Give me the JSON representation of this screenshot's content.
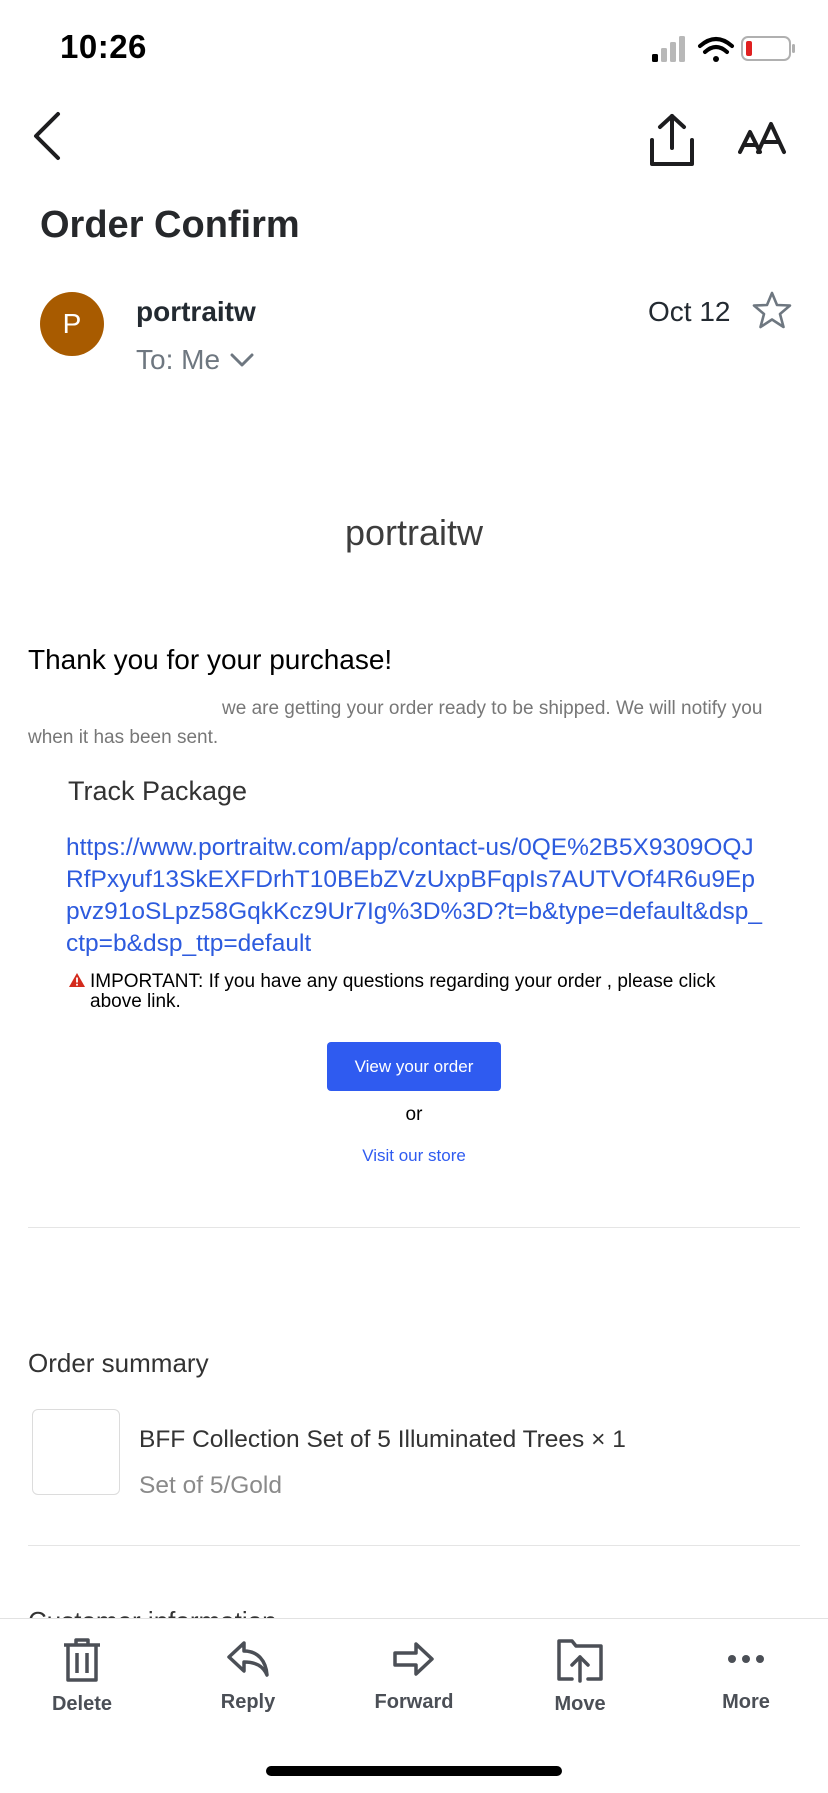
{
  "status_bar": {
    "time": "10:26"
  },
  "email": {
    "subject": "Order Confirm",
    "sender": {
      "initial": "P",
      "name": "portraitw"
    },
    "recipient": "To: Me",
    "date": "Oct 12"
  },
  "body": {
    "brand": "portraitw",
    "thanks": "Thank you for your purchase!",
    "message": "we are getting your order ready to be shipped. We will notify you when it has been sent.",
    "track_title": "Track Package",
    "track_link": "https://www.portraitw.com/app/contact-us/0QE%2B5X9309OQJRfPxyuf13SkEXFDrhT10BEbZVzUxpBFqpIs7AUTVOf4R6u9Eppvz91oSLpz58GqkKcz9Ur7Ig%3D%3D?t=b&type=default&dsp_ctp=b&dsp_ttp=default",
    "important": "IMPORTANT: If you have any questions regarding your order , please click above link.",
    "view_order_label": "View your order",
    "or_text": "or",
    "visit_store_label": "Visit our store"
  },
  "order_summary": {
    "title": "Order summary",
    "items": [
      {
        "name": "BFF Collection Set of 5 Illuminated Trees × 1",
        "variant": "Set of 5/Gold"
      }
    ],
    "next_section_partial": "Customer information"
  },
  "toolbar": {
    "delete": "Delete",
    "reply": "Reply",
    "forward": "Forward",
    "move": "Move",
    "more": "More"
  },
  "colors": {
    "avatar": "#a85b00",
    "link": "#2d5bde",
    "button": "#2f5bf0",
    "battery_low": "#e02020"
  },
  "icons": [
    "signal-icon",
    "wifi-icon",
    "battery-icon",
    "back-icon",
    "share-icon",
    "text-size-icon",
    "star-icon",
    "chevron-down-icon",
    "warning-icon",
    "trash-icon",
    "reply-icon",
    "forward-icon",
    "move-folder-icon",
    "more-dots-icon"
  ]
}
